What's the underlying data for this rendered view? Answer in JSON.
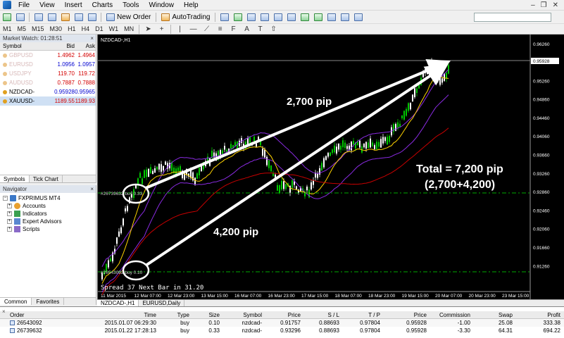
{
  "menu": {
    "items": [
      "File",
      "View",
      "Insert",
      "Charts",
      "Tools",
      "Window",
      "Help"
    ]
  },
  "toolbar": {
    "new_order_label": "New Order",
    "autotrading_label": "AutoTrading",
    "timeframes": [
      "M1",
      "M5",
      "M15",
      "M30",
      "H1",
      "H4",
      "D1",
      "W1",
      "MN"
    ]
  },
  "market_watch": {
    "title": "Market Watch: 01:28:51",
    "headers": {
      "symbol": "Symbol",
      "bid": "Bid",
      "ask": "Ask"
    },
    "rows": [
      {
        "symbol": "GBPUSD",
        "bid": "1.4962",
        "ask": "1.4964",
        "bid_color": "#d40000",
        "ask_color": "#d40000",
        "dim": true
      },
      {
        "symbol": "EURUSD",
        "bid": "1.0956",
        "ask": "1.0957",
        "bid_color": "#0000d0",
        "ask_color": "#0000d0",
        "dim": true
      },
      {
        "symbol": "USDJPY",
        "bid": "119.70",
        "ask": "119.72",
        "bid_color": "#d40000",
        "ask_color": "#d40000",
        "dim": true
      },
      {
        "symbol": "AUDUSD",
        "bid": "0.7887",
        "ask": "0.7888",
        "bid_color": "#d40000",
        "ask_color": "#d40000",
        "dim": true
      },
      {
        "symbol": "NZDCAD-",
        "bid": "0.95928",
        "ask": "0.95965",
        "bid_color": "#0000d0",
        "ask_color": "#0000d0",
        "dim": false
      },
      {
        "symbol": "XAUUSD-",
        "bid": "1189.55",
        "ask": "1189.93",
        "bid_color": "#d40000",
        "ask_color": "#d40000",
        "dim": false,
        "selected": true
      }
    ],
    "tabs": [
      "Symbols",
      "Tick Chart"
    ]
  },
  "navigator": {
    "title": "Navigator",
    "root": "FXPRIMUS MT4",
    "items": [
      "Accounts",
      "Indicators",
      "Expert Advisors",
      "Scripts"
    ],
    "tabs": [
      "Common",
      "Favorites"
    ]
  },
  "chart": {
    "symbol_label": "NZDCAD-,H1",
    "price_labels": [
      "0.96260",
      "0.95928",
      "0.95260",
      "0.94860",
      "0.94460",
      "0.94060",
      "0.93660",
      "0.93260",
      "0.92860",
      "0.92460",
      "0.92060",
      "0.91660",
      "0.91260"
    ],
    "current_price": "0.95928",
    "time_labels": [
      "11 Mar 2015",
      "12 Mar 07:00",
      "12 Mar 23:00",
      "13 Mar 15:00",
      "16 Mar 07:00",
      "16 Mar 23:00",
      "17 Mar 15:00",
      "18 Mar 07:00",
      "18 Mar 23:00",
      "19 Mar 15:00",
      "20 Mar 07:00",
      "20 Mar 23:00",
      "23 Mar 15:00"
    ],
    "annotation_1": "2,700 pip",
    "annotation_2": "4,200 pip",
    "total_line1": "Total = 7,200 pip",
    "total_line2": "(2,700+4,200)",
    "order_label_1": "#26739632 buy 0.33",
    "order_label_2": "#26543092 buy 0.10",
    "status_text": "Spread 37 Next Bar in 31.20",
    "colors": {
      "bull_candle": "#00c800",
      "bear_candle": "#ffffff",
      "ma_fast": "#ffd400",
      "ma_slow": "#c80000",
      "bands": "#8a2be2"
    }
  },
  "chart_tabs": [
    "NZDCAD-,H1",
    "EURUSD,Daily"
  ],
  "terminal": {
    "headers": [
      "Order",
      "Time",
      "Type",
      "Size",
      "Symbol",
      "Price",
      "S / L",
      "T / P",
      "Price",
      "Commission",
      "Swap",
      "Profit"
    ],
    "rows": [
      [
        "26543092",
        "2015.01.07 06:29:30",
        "buy",
        "0.10",
        "nzdcad-",
        "0.91757",
        "0.88693",
        "0.97804",
        "0.95928",
        "-1.00",
        "25.08",
        "333.38"
      ],
      [
        "26739632",
        "2015.01.22 17:28:13",
        "buy",
        "0.33",
        "nzdcad-",
        "0.93296",
        "0.88693",
        "0.97804",
        "0.95928",
        "-3.30",
        "64.31",
        "694.22"
      ]
    ]
  }
}
